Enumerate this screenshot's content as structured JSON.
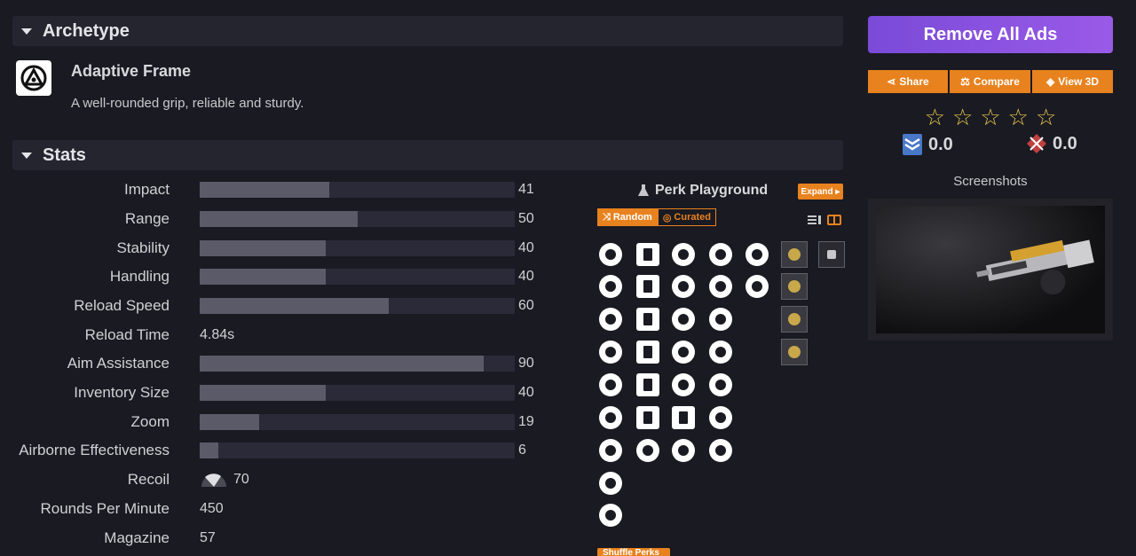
{
  "archetype": {
    "header": "Archetype",
    "name": "Adaptive Frame",
    "description": "A well-rounded grip, reliable and sturdy."
  },
  "stats": {
    "header": "Stats",
    "bars": [
      {
        "label": "Impact",
        "value": "41",
        "fill": 41
      },
      {
        "label": "Range",
        "value": "50",
        "fill": 50
      },
      {
        "label": "Stability",
        "value": "40",
        "fill": 40
      },
      {
        "label": "Handling",
        "value": "40",
        "fill": 40
      },
      {
        "label": "Reload Speed",
        "value": "60",
        "fill": 60
      }
    ],
    "reload_time": {
      "label": "Reload Time",
      "value": "4.84s"
    },
    "bars2": [
      {
        "label": "Aim Assistance",
        "value": "90",
        "fill": 90
      },
      {
        "label": "Inventory Size",
        "value": "40",
        "fill": 40
      },
      {
        "label": "Zoom",
        "value": "19",
        "fill": 19
      },
      {
        "label": "Airborne Effectiveness",
        "value": "6",
        "fill": 6
      }
    ],
    "recoil": {
      "label": "Recoil",
      "value": "70"
    },
    "rpm": {
      "label": "Rounds Per Minute",
      "value": "450"
    },
    "magazine": {
      "label": "Magazine",
      "value": "57"
    }
  },
  "perk_playground": {
    "title": "Perk Playground",
    "expand_label": "Expand ▸",
    "random_label": "Random",
    "curated_label": "Curated",
    "shuffle_label": "Shuffle Perks"
  },
  "sidebar": {
    "remove_ads": "Remove All Ads",
    "share": "Share",
    "compare": "Compare",
    "view3d": "View 3D",
    "pve_rating": "0.0",
    "pvp_rating": "0.0",
    "screenshots_label": "Screenshots"
  },
  "colors": {
    "accent": "#e8821e",
    "purple": "#8a52e0",
    "bar_fill": "#5a5a68",
    "bar_track": "#2a2a38"
  }
}
